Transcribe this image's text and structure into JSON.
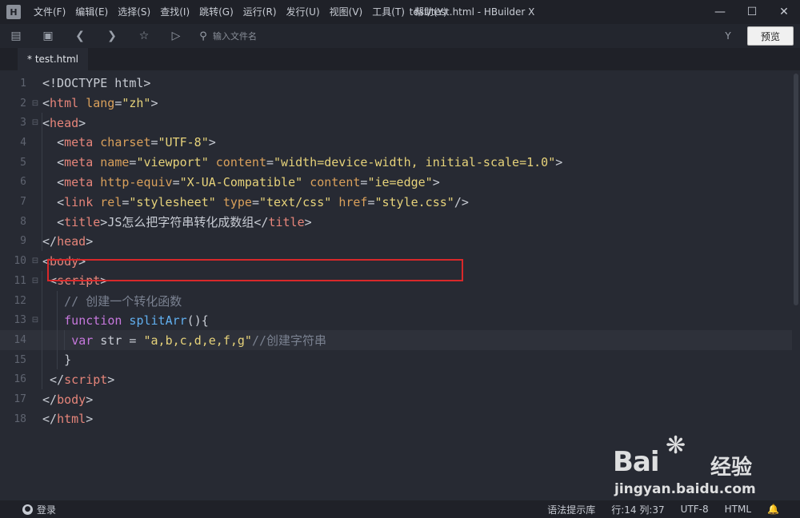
{
  "window": {
    "logo": "H",
    "title": "test/test.html - HBuilder X",
    "menu": [
      "文件(F)",
      "编辑(E)",
      "选择(S)",
      "查找(I)",
      "跳转(G)",
      "运行(R)",
      "发行(U)",
      "视图(V)",
      "工具(T)",
      "帮助(Y)"
    ],
    "controls": [
      "minimize-icon",
      "maximize-icon",
      "close-icon"
    ]
  },
  "toolbar": {
    "icons": [
      "new-file-icon",
      "save-icon",
      "back-icon",
      "forward-icon",
      "star-icon",
      "run-icon",
      "file-search-icon"
    ],
    "file_search_placeholder": "输入文件名",
    "filter_icon": "filter-icon",
    "preview_label": "预览"
  },
  "tabs": [
    {
      "label": "* test.html",
      "active": true
    }
  ],
  "editor": {
    "current_line": 14,
    "lines": [
      {
        "n": "1",
        "fold": "",
        "indent": 0,
        "tokens": [
          [
            "punc",
            "<!DOCTYPE html>"
          ]
        ]
      },
      {
        "n": "2",
        "fold": "⊟",
        "indent": 0,
        "tokens": [
          [
            "punc",
            "<"
          ],
          [
            "tag",
            "html"
          ],
          [
            "plain",
            " "
          ],
          [
            "attr",
            "lang"
          ],
          [
            "punc",
            "="
          ],
          [
            "str",
            "\"zh\""
          ],
          [
            "punc",
            ">"
          ]
        ]
      },
      {
        "n": "3",
        "fold": "⊟",
        "indent": 0,
        "tokens": [
          [
            "punc",
            "<"
          ],
          [
            "tag",
            "head"
          ],
          [
            "punc",
            ">"
          ]
        ]
      },
      {
        "n": "4",
        "fold": "",
        "indent": 1,
        "tokens": [
          [
            "punc",
            "<"
          ],
          [
            "tag",
            "meta"
          ],
          [
            "plain",
            " "
          ],
          [
            "attr",
            "charset"
          ],
          [
            "punc",
            "="
          ],
          [
            "str",
            "\"UTF-8\""
          ],
          [
            "punc",
            ">"
          ]
        ]
      },
      {
        "n": "5",
        "fold": "",
        "indent": 1,
        "tokens": [
          [
            "punc",
            "<"
          ],
          [
            "tag",
            "meta"
          ],
          [
            "plain",
            " "
          ],
          [
            "attr",
            "name"
          ],
          [
            "punc",
            "="
          ],
          [
            "str",
            "\"viewport\""
          ],
          [
            "plain",
            " "
          ],
          [
            "attr",
            "content"
          ],
          [
            "punc",
            "="
          ],
          [
            "str",
            "\"width=device-width, initial-scale=1.0\""
          ],
          [
            "punc",
            ">"
          ]
        ]
      },
      {
        "n": "6",
        "fold": "",
        "indent": 1,
        "tokens": [
          [
            "punc",
            "<"
          ],
          [
            "tag",
            "meta"
          ],
          [
            "plain",
            " "
          ],
          [
            "attr",
            "http-equiv"
          ],
          [
            "punc",
            "="
          ],
          [
            "str",
            "\"X-UA-Compatible\""
          ],
          [
            "plain",
            " "
          ],
          [
            "attr",
            "content"
          ],
          [
            "punc",
            "="
          ],
          [
            "str",
            "\"ie=edge\""
          ],
          [
            "punc",
            ">"
          ]
        ]
      },
      {
        "n": "7",
        "fold": "",
        "indent": 1,
        "tokens": [
          [
            "punc",
            "<"
          ],
          [
            "tag",
            "link"
          ],
          [
            "plain",
            " "
          ],
          [
            "attr",
            "rel"
          ],
          [
            "punc",
            "="
          ],
          [
            "str",
            "\"stylesheet\""
          ],
          [
            "plain",
            " "
          ],
          [
            "attr",
            "type"
          ],
          [
            "punc",
            "="
          ],
          [
            "str",
            "\"text/css\""
          ],
          [
            "plain",
            " "
          ],
          [
            "attr",
            "href"
          ],
          [
            "punc",
            "="
          ],
          [
            "str",
            "\"style.css\""
          ],
          [
            "punc",
            "/>"
          ]
        ]
      },
      {
        "n": "8",
        "fold": "",
        "indent": 1,
        "tokens": [
          [
            "punc",
            "<"
          ],
          [
            "tag",
            "title"
          ],
          [
            "punc",
            ">"
          ],
          [
            "plain",
            "JS怎么把字符串转化成数组"
          ],
          [
            "punc",
            "</"
          ],
          [
            "tag",
            "title"
          ],
          [
            "punc",
            ">"
          ]
        ]
      },
      {
        "n": "9",
        "fold": "",
        "indent": 0,
        "tokens": [
          [
            "punc",
            "</"
          ],
          [
            "tag",
            "head"
          ],
          [
            "punc",
            ">"
          ]
        ]
      },
      {
        "n": "10",
        "fold": "⊟",
        "indent": 0,
        "tokens": [
          [
            "punc",
            "<"
          ],
          [
            "tag",
            "body"
          ],
          [
            "punc",
            ">"
          ]
        ]
      },
      {
        "n": "11",
        "fold": "⊟",
        "indent": 0.5,
        "tokens": [
          [
            "punc",
            "<"
          ],
          [
            "tag",
            "script"
          ],
          [
            "punc",
            ">"
          ]
        ]
      },
      {
        "n": "12",
        "fold": "",
        "indent": 1.5,
        "tokens": [
          [
            "cmt",
            "// 创建一个转化函数"
          ]
        ]
      },
      {
        "n": "13",
        "fold": "⊟",
        "indent": 1.5,
        "tokens": [
          [
            "kw",
            "function"
          ],
          [
            "plain",
            " "
          ],
          [
            "fn",
            "splitArr"
          ],
          [
            "punc",
            "(){"
          ]
        ]
      },
      {
        "n": "14",
        "fold": "",
        "indent": 2,
        "tokens": [
          [
            "kw",
            "var"
          ],
          [
            "plain",
            " str = "
          ],
          [
            "str",
            "\"a,b,c,d,e,f,g\""
          ],
          [
            "cmt",
            "//创建字符串"
          ]
        ]
      },
      {
        "n": "15",
        "fold": "",
        "indent": 1.5,
        "tokens": [
          [
            "punc",
            "}"
          ]
        ]
      },
      {
        "n": "16",
        "fold": "",
        "indent": 0.5,
        "tokens": [
          [
            "punc",
            "</"
          ],
          [
            "tag",
            "script"
          ],
          [
            "punc",
            ">"
          ]
        ]
      },
      {
        "n": "17",
        "fold": "",
        "indent": 0,
        "tokens": [
          [
            "punc",
            "</"
          ],
          [
            "tag",
            "body"
          ],
          [
            "punc",
            ">"
          ]
        ]
      },
      {
        "n": "18",
        "fold": "",
        "indent": 0,
        "tokens": [
          [
            "punc",
            "</"
          ],
          [
            "tag",
            "html"
          ],
          [
            "punc",
            ">"
          ]
        ]
      }
    ]
  },
  "watermark": {
    "brand": "Bai",
    "brand_suffix": "经验",
    "url": "jingyan.baidu.com"
  },
  "statusbar": {
    "login_label": "登录",
    "syntax_hint": "语法提示库",
    "position": "行:14   列:37",
    "encoding": "UTF-8",
    "language": "HTML"
  },
  "colors": {
    "background": "#272a33",
    "tag": "#e6857a",
    "attr": "#d9a05b",
    "string": "#e6d27a",
    "keyword": "#c678dd",
    "function": "#61afef",
    "comment": "#7a8190",
    "highlight_box": "#d8282a"
  }
}
